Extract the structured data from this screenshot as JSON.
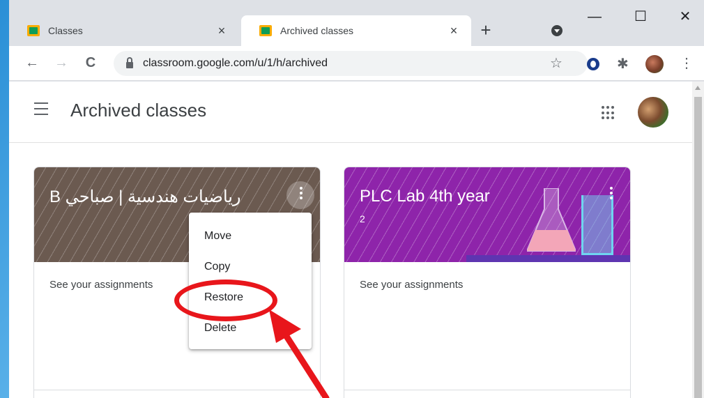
{
  "browser": {
    "tabs": [
      {
        "title": "Classes",
        "close": "×"
      },
      {
        "title": "Archived classes",
        "close": "×"
      }
    ],
    "new_tab": "+",
    "window_controls": {
      "minimize": "—",
      "maximize": "☐",
      "close": "✕"
    },
    "toolbar": {
      "back": "←",
      "forward": "→",
      "reload": "C",
      "url": "classroom.google.com/u/1/h/archived",
      "star": "☆",
      "extensions": "✱",
      "menu": "⋮"
    }
  },
  "page": {
    "title": "Archived classes"
  },
  "classes": [
    {
      "title": "رياضيات هندسية | صباحي B",
      "subtitle": "",
      "link": "See your assignments"
    },
    {
      "title": "PLC Lab 4th year",
      "subtitle": "2",
      "link": "See your assignments"
    }
  ],
  "context_menu": {
    "items": [
      "Move",
      "Copy",
      "Restore",
      "Delete"
    ]
  },
  "annotation": {
    "highlight_color": "#e8161b"
  }
}
